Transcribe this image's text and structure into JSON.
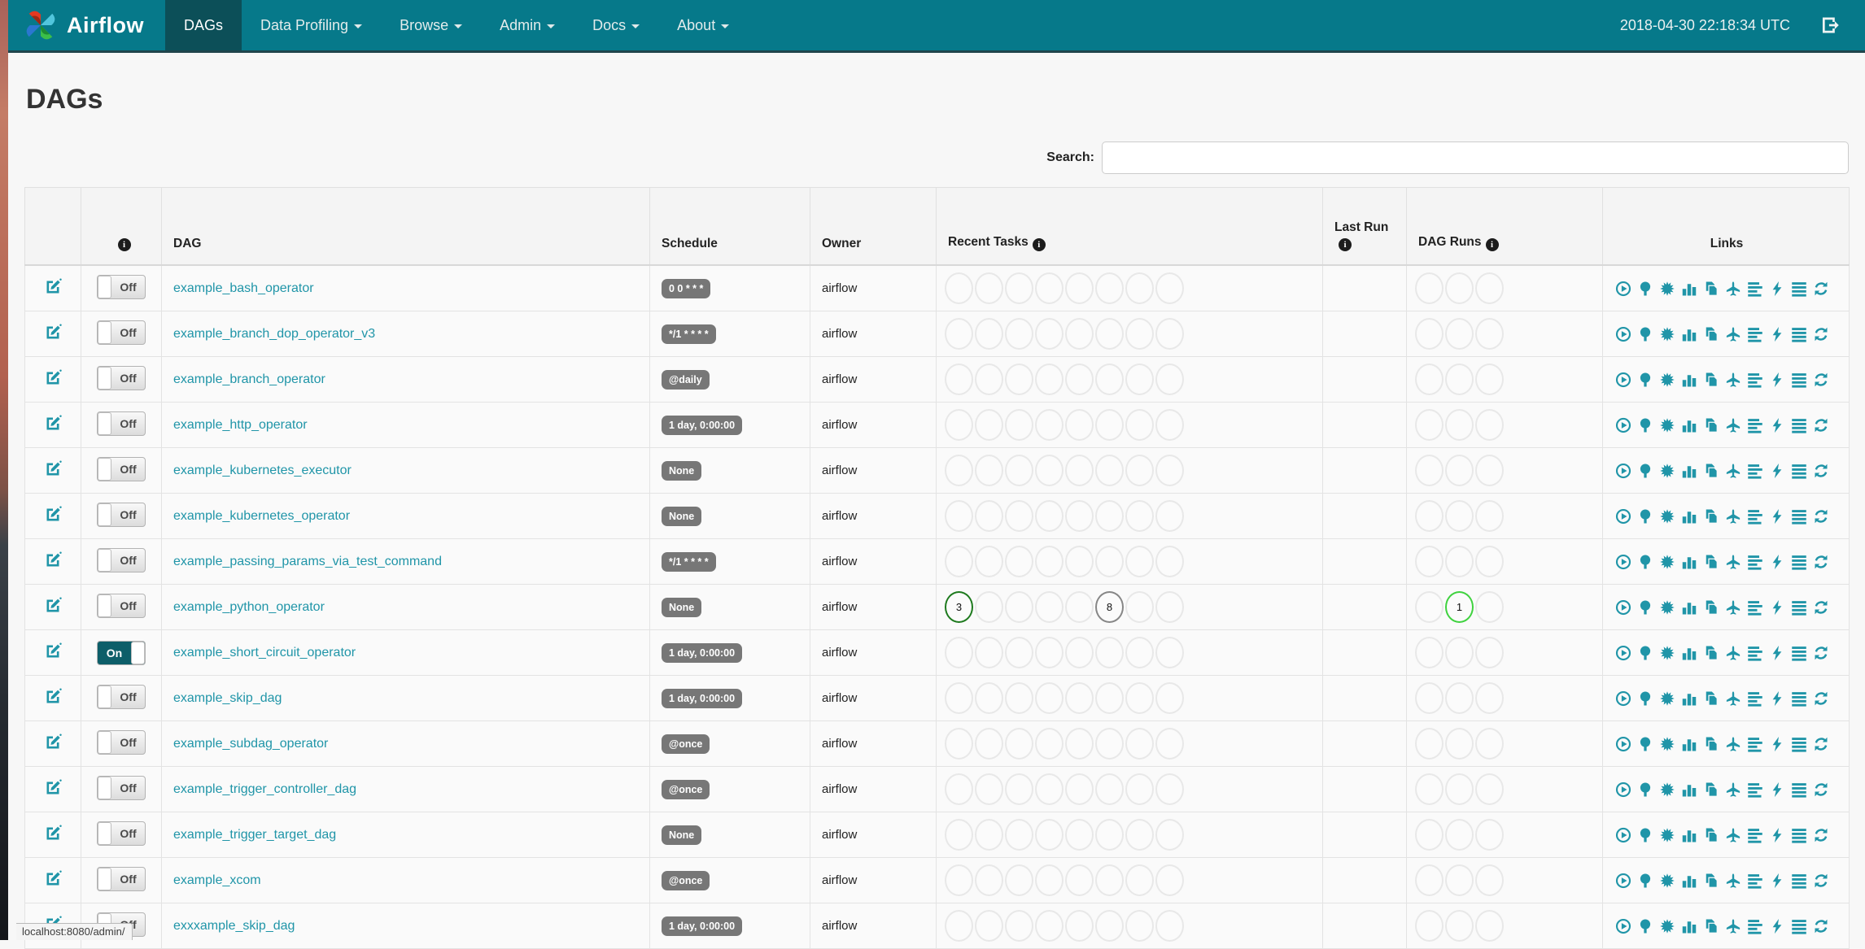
{
  "navbar": {
    "brand": "Airflow",
    "items": [
      {
        "label": "DAGs",
        "active": true,
        "dropdown": false
      },
      {
        "label": "Data Profiling",
        "active": false,
        "dropdown": true
      },
      {
        "label": "Browse",
        "active": false,
        "dropdown": true
      },
      {
        "label": "Admin",
        "active": false,
        "dropdown": true
      },
      {
        "label": "Docs",
        "active": false,
        "dropdown": true
      },
      {
        "label": "About",
        "active": false,
        "dropdown": true
      }
    ],
    "clock": "2018-04-30 22:18:34 UTC"
  },
  "page": {
    "title": "DAGs",
    "search_label": "Search:",
    "search_value": "",
    "status_bar_url": "localhost:8080/admin/"
  },
  "table": {
    "headers": {
      "dag": "DAG",
      "schedule": "Schedule",
      "owner": "Owner",
      "recent_tasks": "Recent Tasks",
      "last_run": "Last Run",
      "dag_runs": "DAG Runs",
      "links": "Links"
    },
    "recent_task_slots": 8,
    "dag_run_slots": 3,
    "rows": [
      {
        "dag": "example_bash_operator",
        "enabled": false,
        "toggle_label": "Off",
        "schedule": "0 0 * * *",
        "owner": "airflow",
        "last_run": "",
        "recent": [],
        "runs": []
      },
      {
        "dag": "example_branch_dop_operator_v3",
        "enabled": false,
        "toggle_label": "Off",
        "schedule": "*/1 * * * *",
        "owner": "airflow",
        "last_run": "",
        "recent": [],
        "runs": []
      },
      {
        "dag": "example_branch_operator",
        "enabled": false,
        "toggle_label": "Off",
        "schedule": "@daily",
        "owner": "airflow",
        "last_run": "",
        "recent": [],
        "runs": []
      },
      {
        "dag": "example_http_operator",
        "enabled": false,
        "toggle_label": "Off",
        "schedule": "1 day, 0:00:00",
        "owner": "airflow",
        "last_run": "",
        "recent": [],
        "runs": []
      },
      {
        "dag": "example_kubernetes_executor",
        "enabled": false,
        "toggle_label": "Off",
        "schedule": "None",
        "owner": "airflow",
        "last_run": "",
        "recent": [],
        "runs": []
      },
      {
        "dag": "example_kubernetes_operator",
        "enabled": false,
        "toggle_label": "Off",
        "schedule": "None",
        "owner": "airflow",
        "last_run": "",
        "recent": [],
        "runs": []
      },
      {
        "dag": "example_passing_params_via_test_command",
        "enabled": false,
        "toggle_label": "Off",
        "schedule": "*/1 * * * *",
        "owner": "airflow",
        "last_run": "",
        "recent": [],
        "runs": []
      },
      {
        "dag": "example_python_operator",
        "enabled": false,
        "toggle_label": "Off",
        "schedule": "None",
        "owner": "airflow",
        "last_run": "",
        "recent": [
          {
            "slot": 0,
            "count": "3",
            "color": "#1e7a1e"
          },
          {
            "slot": 5,
            "count": "8",
            "color": "#868686"
          }
        ],
        "runs": [
          {
            "slot": 1,
            "count": "1",
            "color": "#3fd23f"
          }
        ]
      },
      {
        "dag": "example_short_circuit_operator",
        "enabled": true,
        "toggle_label": "On",
        "schedule": "1 day, 0:00:00",
        "owner": "airflow",
        "last_run": "",
        "recent": [],
        "runs": []
      },
      {
        "dag": "example_skip_dag",
        "enabled": false,
        "toggle_label": "Off",
        "schedule": "1 day, 0:00:00",
        "owner": "airflow",
        "last_run": "",
        "recent": [],
        "runs": []
      },
      {
        "dag": "example_subdag_operator",
        "enabled": false,
        "toggle_label": "Off",
        "schedule": "@once",
        "owner": "airflow",
        "last_run": "",
        "recent": [],
        "runs": []
      },
      {
        "dag": "example_trigger_controller_dag",
        "enabled": false,
        "toggle_label": "Off",
        "schedule": "@once",
        "owner": "airflow",
        "last_run": "",
        "recent": [],
        "runs": []
      },
      {
        "dag": "example_trigger_target_dag",
        "enabled": false,
        "toggle_label": "Off",
        "schedule": "None",
        "owner": "airflow",
        "last_run": "",
        "recent": [],
        "runs": []
      },
      {
        "dag": "example_xcom",
        "enabled": false,
        "toggle_label": "Off",
        "schedule": "@once",
        "owner": "airflow",
        "last_run": "",
        "recent": [],
        "runs": []
      },
      {
        "dag": "exxxample_skip_dag",
        "enabled": false,
        "toggle_label": "Off",
        "schedule": "1 day, 0:00:00",
        "owner": "airflow",
        "last_run": "",
        "recent": [],
        "runs": []
      }
    ]
  },
  "links": {
    "icons": [
      "trigger-dag",
      "tree-view",
      "graph-view",
      "task-duration",
      "task-tries",
      "landing-times",
      "gantt-view",
      "code-view",
      "logs",
      "refresh"
    ]
  },
  "colors": {
    "navbar": "#06798a",
    "navbar_active": "#0c4f58",
    "link_teal": "#2095a8",
    "badge_grey": "#777777",
    "toggle_on": "#0d5e69",
    "circle_success_green": "#1e7a1e",
    "circle_queued_grey": "#868686",
    "circle_running_green": "#3fd23f"
  }
}
